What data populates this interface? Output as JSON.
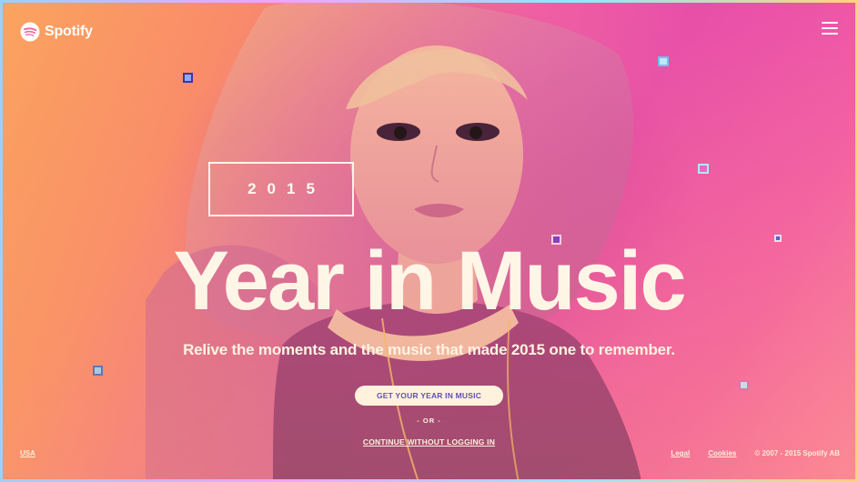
{
  "brand": {
    "name": "Spotify"
  },
  "hero": {
    "year": "2015",
    "headline": "Year in Music",
    "tagline": "Relive the moments and the music that made 2015 one to remember."
  },
  "actions": {
    "primary_label": "GET YOUR YEAR IN MUSIC",
    "divider_label": "- OR -",
    "secondary_label": "CONTINUE WITHOUT LOGGING IN"
  },
  "footer": {
    "region": "USA",
    "legal_label": "Legal",
    "cookies_label": "Cookies",
    "copyright": "© 2007 - 2015 Spotify AB"
  },
  "icons": {
    "logo": "spotify-logo-icon",
    "menu": "hamburger-menu-icon"
  },
  "colors": {
    "accent_pink": "#ef5fa3",
    "accent_orange": "#fba45e",
    "button_text": "#3a33c8"
  }
}
